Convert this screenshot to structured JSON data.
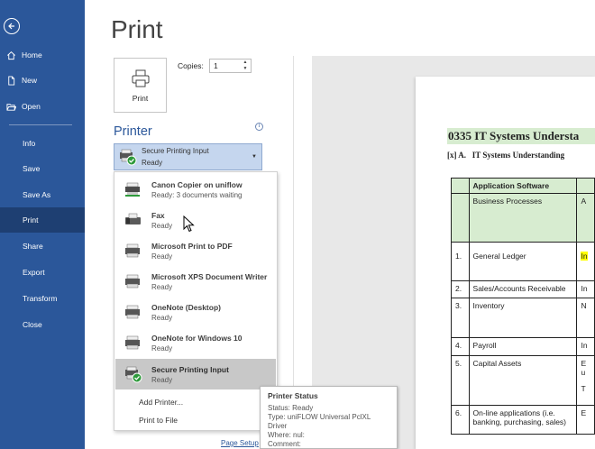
{
  "nav": {
    "items": [
      {
        "label": "Home",
        "icon": "home-icon"
      },
      {
        "label": "New",
        "icon": "new-document-icon"
      },
      {
        "label": "Open",
        "icon": "folder-open-icon"
      },
      {
        "label": "Info"
      },
      {
        "label": "Save"
      },
      {
        "label": "Save As"
      },
      {
        "label": "Print",
        "active": true
      },
      {
        "label": "Share"
      },
      {
        "label": "Export"
      },
      {
        "label": "Transform"
      },
      {
        "label": "Close"
      }
    ]
  },
  "print": {
    "title": "Print",
    "print_button_label": "Print",
    "copies_label": "Copies:",
    "copies_value": "1",
    "printer_section_label": "Printer",
    "info_glyph": "i",
    "selected_printer": {
      "name": "Secure Printing Input",
      "status": "Ready"
    },
    "printers": [
      {
        "name": "Canon Copier on uniflow",
        "status": "Ready: 3 documents waiting"
      },
      {
        "name": "Fax",
        "status": "Ready"
      },
      {
        "name": "Microsoft Print to PDF",
        "status": "Ready"
      },
      {
        "name": "Microsoft XPS Document Writer",
        "status": "Ready"
      },
      {
        "name": "OneNote (Desktop)",
        "status": "Ready"
      },
      {
        "name": "OneNote for Windows 10",
        "status": "Ready"
      },
      {
        "name": "Secure Printing Input",
        "status": "Ready",
        "selected": true
      }
    ],
    "add_printer": "Add Printer...",
    "print_to_file": "Print to File",
    "page_setup": "Page Setup"
  },
  "tooltip": {
    "title": "Printer Status",
    "status": "Status: Ready",
    "type": "Type: uniFLOW Universal PclXL",
    "type_cont": "Driver",
    "where": "Where: nul:",
    "comment": "Comment:"
  },
  "document": {
    "heading": "0335 IT Systems Understa",
    "sub_marker": "[x] A.",
    "sub_title": "IT Systems Understanding",
    "col_app": "Application Software",
    "col_business": "Business Processes",
    "col_business_next": "A",
    "rows": [
      {
        "num": "1.",
        "name": "General Ledger",
        "next": "In",
        "highlight": true
      },
      {
        "num": "2.",
        "name": "Sales/Accounts Receivable",
        "next": "In"
      },
      {
        "num": "3.",
        "name": "Inventory",
        "next": "N"
      },
      {
        "num": "4.",
        "name": "Payroll",
        "next": "In"
      },
      {
        "num": "5.",
        "name": "Capital Assets",
        "next": "E"
      },
      {
        "num": "6.",
        "name": "On-line applications (i.e. banking, purchasing, sales)",
        "next": "E"
      }
    ],
    "row5_extra": [
      "u",
      "T"
    ]
  },
  "colors": {
    "nav_bg": "#2b579a",
    "nav_active": "#1e3f72",
    "accent": "#2b579a",
    "doc_green": "#d7ecd0",
    "highlight": "#ffff00"
  }
}
